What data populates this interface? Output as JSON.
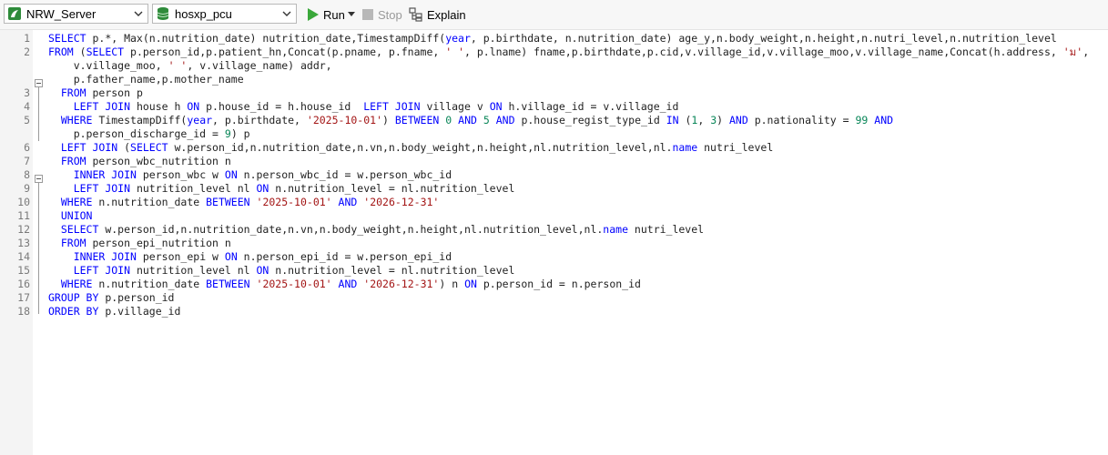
{
  "toolbar": {
    "connection": "NRW_Server",
    "database": "hosxp_pcu",
    "run_label": "Run",
    "stop_label": "Stop",
    "explain_label": "Explain",
    "colors": {
      "run_green": "#3aa83a",
      "db_green": "#2e8b3a",
      "stop_gray": "#b8b8b8"
    }
  },
  "editor": {
    "lines": [
      {
        "n": "1",
        "tokens": [
          [
            "kw",
            "SELECT"
          ],
          [
            "t",
            " p.*, Max(n.nutrition_date) nutrition_date,TimestampDiff("
          ],
          [
            "kw",
            "year"
          ],
          [
            "t",
            ", p.birthdate, n.nutrition_date) age_y,n.body_weight,n.height,n.nutri_level,n.nutrition_level"
          ]
        ]
      },
      {
        "n": "2",
        "tokens": [
          [
            "kw",
            "FROM"
          ],
          [
            "t",
            " ("
          ],
          [
            "kw",
            "SELECT"
          ],
          [
            "t",
            " p.person_id,p.patient_hn,Concat(p.pname, p.fname, "
          ],
          [
            "str",
            "' '"
          ],
          [
            "t",
            ", p.lname) fname,p.birthdate,p.cid,v.village_id,v.village_moo,v.village_name,Concat(h.address, "
          ],
          [
            "str",
            "'ม'"
          ],
          [
            "t",
            ","
          ]
        ]
      },
      {
        "n": "",
        "tokens": [
          [
            "t",
            "    v.village_moo, "
          ],
          [
            "str",
            "' '"
          ],
          [
            "t",
            ", v.village_name) addr,"
          ]
        ]
      },
      {
        "n": "",
        "tokens": [
          [
            "t",
            "    p.father_name,p.mother_name"
          ]
        ]
      },
      {
        "n": "3",
        "tokens": [
          [
            "t",
            "  "
          ],
          [
            "kw",
            "FROM"
          ],
          [
            "t",
            " person p"
          ]
        ]
      },
      {
        "n": "4",
        "tokens": [
          [
            "t",
            "    "
          ],
          [
            "kw",
            "LEFT JOIN"
          ],
          [
            "t",
            " house h "
          ],
          [
            "kw",
            "ON"
          ],
          [
            "t",
            " p.house_id = h.house_id  "
          ],
          [
            "kw",
            "LEFT JOIN"
          ],
          [
            "t",
            " village v "
          ],
          [
            "kw",
            "ON"
          ],
          [
            "t",
            " h.village_id = v.village_id"
          ]
        ]
      },
      {
        "n": "5",
        "tokens": [
          [
            "t",
            "  "
          ],
          [
            "kw",
            "WHERE"
          ],
          [
            "t",
            " TimestampDiff("
          ],
          [
            "kw",
            "year"
          ],
          [
            "t",
            ", p.birthdate, "
          ],
          [
            "str",
            "'2025-10-01'"
          ],
          [
            "t",
            ") "
          ],
          [
            "kw",
            "BETWEEN"
          ],
          [
            "t",
            " "
          ],
          [
            "num",
            "0"
          ],
          [
            "t",
            " "
          ],
          [
            "kw",
            "AND"
          ],
          [
            "t",
            " "
          ],
          [
            "num",
            "5"
          ],
          [
            "t",
            " "
          ],
          [
            "kw",
            "AND"
          ],
          [
            "t",
            " p.house_regist_type_id "
          ],
          [
            "kw",
            "IN"
          ],
          [
            "t",
            " ("
          ],
          [
            "num",
            "1"
          ],
          [
            "t",
            ", "
          ],
          [
            "num",
            "3"
          ],
          [
            "t",
            ") "
          ],
          [
            "kw",
            "AND"
          ],
          [
            "t",
            " p.nationality = "
          ],
          [
            "num",
            "99"
          ],
          [
            "t",
            " "
          ],
          [
            "kw",
            "AND"
          ]
        ]
      },
      {
        "n": "",
        "tokens": [
          [
            "t",
            "    p.person_discharge_id = "
          ],
          [
            "num",
            "9"
          ],
          [
            "t",
            ") p"
          ]
        ]
      },
      {
        "n": "6",
        "tokens": [
          [
            "t",
            "  "
          ],
          [
            "kw",
            "LEFT JOIN"
          ],
          [
            "t",
            " ("
          ],
          [
            "kw",
            "SELECT"
          ],
          [
            "t",
            " w.person_id,n.nutrition_date,n.vn,n.body_weight,n.height,nl.nutrition_level,nl."
          ],
          [
            "kw",
            "name"
          ],
          [
            "t",
            " nutri_level"
          ]
        ]
      },
      {
        "n": "7",
        "tokens": [
          [
            "t",
            "  "
          ],
          [
            "kw",
            "FROM"
          ],
          [
            "t",
            " person_wbc_nutrition n"
          ]
        ]
      },
      {
        "n": "8",
        "tokens": [
          [
            "t",
            "    "
          ],
          [
            "kw",
            "INNER JOIN"
          ],
          [
            "t",
            " person_wbc w "
          ],
          [
            "kw",
            "ON"
          ],
          [
            "t",
            " n.person_wbc_id = w.person_wbc_id"
          ]
        ]
      },
      {
        "n": "9",
        "tokens": [
          [
            "t",
            "    "
          ],
          [
            "kw",
            "LEFT JOIN"
          ],
          [
            "t",
            " nutrition_level nl "
          ],
          [
            "kw",
            "ON"
          ],
          [
            "t",
            " n.nutrition_level = nl.nutrition_level"
          ]
        ]
      },
      {
        "n": "10",
        "tokens": [
          [
            "t",
            "  "
          ],
          [
            "kw",
            "WHERE"
          ],
          [
            "t",
            " n.nutrition_date "
          ],
          [
            "kw",
            "BETWEEN"
          ],
          [
            "t",
            " "
          ],
          [
            "str",
            "'2025-10-01'"
          ],
          [
            "t",
            " "
          ],
          [
            "kw",
            "AND"
          ],
          [
            "t",
            " "
          ],
          [
            "str",
            "'2026-12-31'"
          ]
        ]
      },
      {
        "n": "11",
        "tokens": [
          [
            "t",
            "  "
          ],
          [
            "kw",
            "UNION"
          ]
        ]
      },
      {
        "n": "12",
        "tokens": [
          [
            "t",
            "  "
          ],
          [
            "kw",
            "SELECT"
          ],
          [
            "t",
            " w.person_id,n.nutrition_date,n.vn,n.body_weight,n.height,nl.nutrition_level,nl."
          ],
          [
            "kw",
            "name"
          ],
          [
            "t",
            " nutri_level"
          ]
        ]
      },
      {
        "n": "13",
        "tokens": [
          [
            "t",
            "  "
          ],
          [
            "kw",
            "FROM"
          ],
          [
            "t",
            " person_epi_nutrition n"
          ]
        ]
      },
      {
        "n": "14",
        "tokens": [
          [
            "t",
            "    "
          ],
          [
            "kw",
            "INNER JOIN"
          ],
          [
            "t",
            " person_epi w "
          ],
          [
            "kw",
            "ON"
          ],
          [
            "t",
            " n.person_epi_id = w.person_epi_id"
          ]
        ]
      },
      {
        "n": "15",
        "tokens": [
          [
            "t",
            "    "
          ],
          [
            "kw",
            "LEFT JOIN"
          ],
          [
            "t",
            " nutrition_level nl "
          ],
          [
            "kw",
            "ON"
          ],
          [
            "t",
            " n.nutrition_level = nl.nutrition_level"
          ]
        ]
      },
      {
        "n": "16",
        "tokens": [
          [
            "t",
            "  "
          ],
          [
            "kw",
            "WHERE"
          ],
          [
            "t",
            " n.nutrition_date "
          ],
          [
            "kw",
            "BETWEEN"
          ],
          [
            "t",
            " "
          ],
          [
            "str",
            "'2025-10-01'"
          ],
          [
            "t",
            " "
          ],
          [
            "kw",
            "AND"
          ],
          [
            "t",
            " "
          ],
          [
            "str",
            "'2026-12-31'"
          ],
          [
            "t",
            ") n "
          ],
          [
            "kw",
            "ON"
          ],
          [
            "t",
            " p.person_id = n.person_id"
          ]
        ]
      },
      {
        "n": "17",
        "tokens": [
          [
            "kw",
            "GROUP BY"
          ],
          [
            "t",
            " p.person_id"
          ]
        ]
      },
      {
        "n": "18",
        "tokens": [
          [
            "kw",
            "ORDER BY"
          ],
          [
            "t",
            " p.village_id"
          ]
        ]
      }
    ]
  }
}
